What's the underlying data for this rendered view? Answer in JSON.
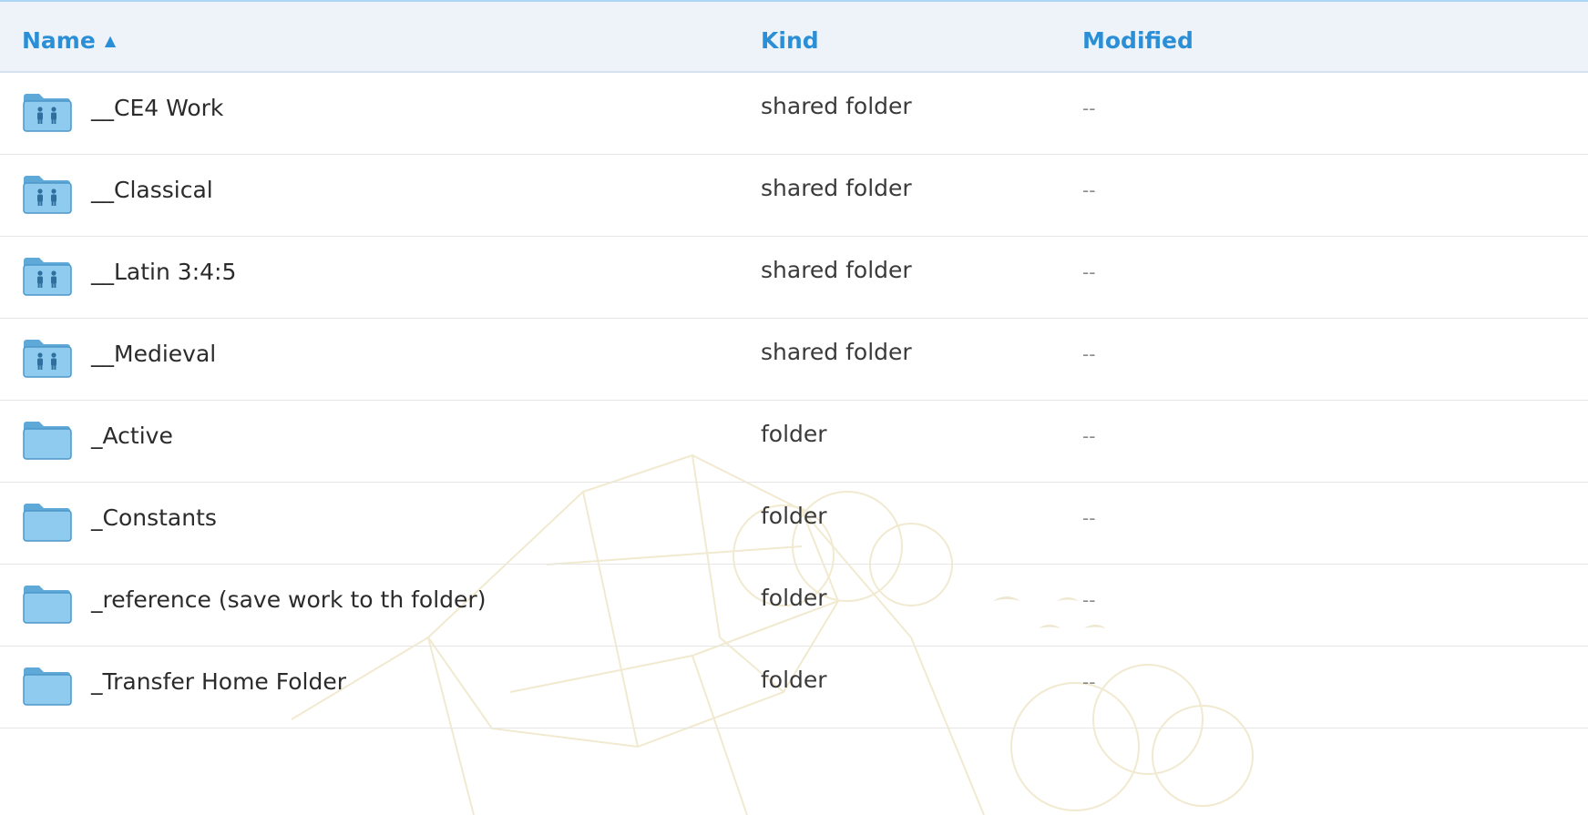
{
  "header": {
    "name_label": "Name",
    "sort_indicator": "▲",
    "kind_label": "Kind",
    "modified_label": "Modified"
  },
  "colors": {
    "accent": "#2a8fd6",
    "header_bg": "#eef3f9",
    "folder_blue": "#7cc4ee"
  },
  "rows": [
    {
      "name": "__CE4 Work",
      "kind": "shared folder",
      "modified": "--",
      "icon": "shared-folder-icon"
    },
    {
      "name": "__Classical",
      "kind": "shared folder",
      "modified": "--",
      "icon": "shared-folder-icon"
    },
    {
      "name": "__Latin 3:4:5",
      "kind": "shared folder",
      "modified": "--",
      "icon": "shared-folder-icon"
    },
    {
      "name": "__Medieval",
      "kind": "shared folder",
      "modified": "--",
      "icon": "shared-folder-icon"
    },
    {
      "name": "_Active",
      "kind": "folder",
      "modified": "--",
      "icon": "folder-icon"
    },
    {
      "name": "_Constants",
      "kind": "folder",
      "modified": "--",
      "icon": "folder-icon"
    },
    {
      "name": "_reference (save work to th folder)",
      "kind": "folder",
      "modified": "--",
      "icon": "folder-icon"
    },
    {
      "name": "_Transfer Home Folder",
      "kind": "folder",
      "modified": "--",
      "icon": "folder-icon"
    }
  ]
}
